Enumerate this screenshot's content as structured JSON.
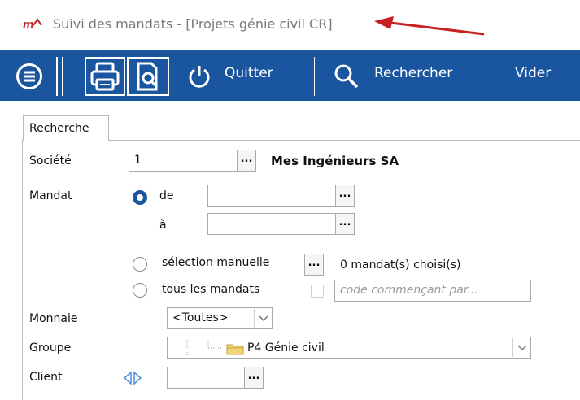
{
  "window": {
    "logo_text": "m",
    "title": "Suivi des mandats - [Projets génie civil CR]"
  },
  "toolbar": {
    "menu_icon": "hamburger-circle-icon",
    "print_icon": "printer-icon",
    "preview_icon": "print-preview-icon",
    "quit_icon": "power-icon",
    "quit_label": "Quitter",
    "search_icon": "magnifier-icon",
    "search_label": "Rechercher",
    "clear_label": "Vider",
    "accent": "#1a55a0"
  },
  "tabs": [
    {
      "label": "Recherche"
    }
  ],
  "form": {
    "societe_label": "Société",
    "societe_value": "1",
    "societe_name": "Mes Ingénieurs SA",
    "mandat_label": "Mandat",
    "de_label": "de",
    "a_label": "à",
    "de_value": "",
    "a_value": "",
    "selection_label": "sélection manuelle",
    "chosen_count": "0 mandat(s) choisi(s)",
    "tous_label": "tous les mandats",
    "code_placeholder": "code commençant par...",
    "monnaie_label": "Monnaie",
    "monnaie_value": "<Toutes>",
    "groupe_label": "Groupe",
    "groupe_value": "P4 Génie civil",
    "client_label": "Client",
    "client_value": "",
    "dots": "..."
  }
}
